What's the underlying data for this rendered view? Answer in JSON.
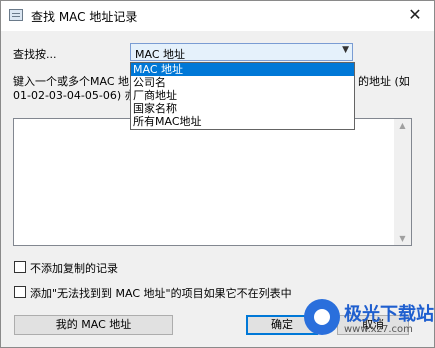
{
  "window": {
    "title": "查找 MAC 地址记录",
    "close_glyph": "✕"
  },
  "search_by": {
    "label": "查找按...",
    "selected": "MAC 地址",
    "options": [
      "MAC 地址",
      "公司名",
      "厂商地址",
      "国家名称",
      "所有MAC地址"
    ]
  },
  "instructions": {
    "line1_left": "键入一个或多个MAC 地",
    "line1_right": "的地址 (如",
    "line2": "01-02-03-04-05-06) 亦可"
  },
  "input_area": {
    "value": ""
  },
  "options": {
    "no_duplicates": {
      "label": "不添加复制的记录",
      "checked": false
    },
    "add_not_found": {
      "label": "添加\"无法找到到 MAC 地址\"的项目如果它不在列表中",
      "checked": false
    }
  },
  "buttons": {
    "my_mac": "我的 MAC 地址",
    "ok": "确定",
    "cancel": "取消"
  },
  "watermark": {
    "text": "极光下载站",
    "sub": "www.xz7.com"
  }
}
